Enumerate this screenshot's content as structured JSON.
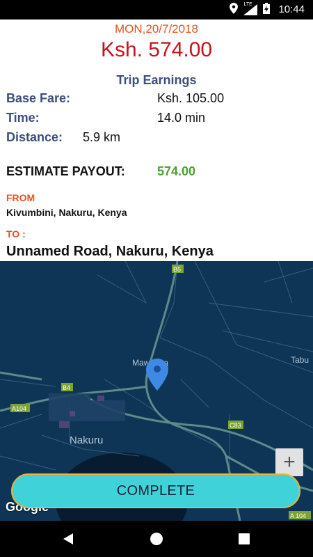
{
  "status_bar": {
    "network": "LTE",
    "time": "10:44",
    "icons": [
      "location-icon",
      "signal-icon",
      "battery-charging-icon"
    ]
  },
  "header": {
    "date": "MON,20/7/2018",
    "total": "Ksh. 574.00"
  },
  "earnings": {
    "title": "Trip Earnings",
    "base_fare_label": "Base Fare:",
    "base_fare_value": "Ksh. 105.00",
    "time_label": "Time:",
    "time_value": "14.0 min",
    "distance_label": "Distance:",
    "distance_value": "5.9 km",
    "payout_label": "ESTIMATE PAYOUT:",
    "payout_value": "574.00",
    "from_label": "FROM",
    "from_value": "Kivumbini, Nakuru, Kenya",
    "to_label": "TO :",
    "to_value": "Unnamed Road, Nakuru, Kenya"
  },
  "map": {
    "place_labels": [
      "Nakuru",
      "Mawanga",
      "Tabu"
    ],
    "road_labels": [
      "B5",
      "B4",
      "A104",
      "C83",
      "A 104"
    ],
    "zoom_in": "+",
    "attribution": "Google"
  },
  "actions": {
    "complete_label": "COMPLETE"
  },
  "navigation": {
    "buttons": [
      "back-icon",
      "home-icon",
      "recents-icon"
    ]
  },
  "colors": {
    "date": "#e8521e",
    "total": "#c8111a",
    "payout": "#4aa131",
    "button": "#3fd3d9",
    "map_background": "#0e3556"
  }
}
